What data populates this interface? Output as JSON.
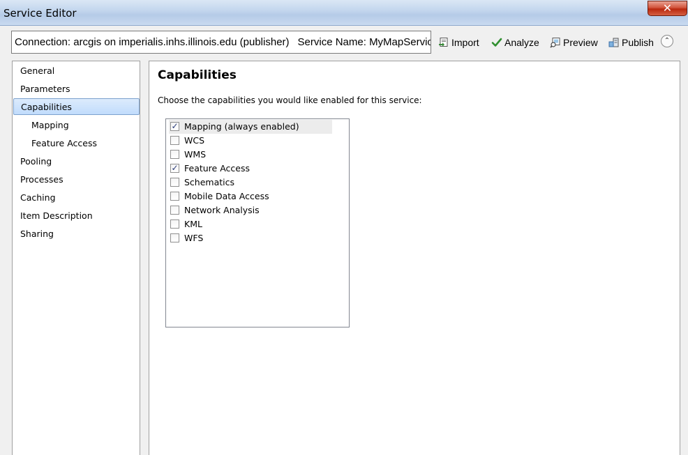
{
  "window": {
    "title": "Service Editor",
    "close_label": "✕"
  },
  "header": {
    "connection_text": "Connection: arcgis on imperialis.inhs.illinois.edu (publisher)",
    "service_text": "Service Name: MyMapService"
  },
  "toolbar": {
    "import_label": "Import",
    "analyze_label": "Analyze",
    "preview_label": "Preview",
    "publish_label": "Publish",
    "collapse_label": "⌃"
  },
  "sidebar": {
    "items": [
      {
        "label": "General"
      },
      {
        "label": "Parameters"
      },
      {
        "label": "Capabilities"
      },
      {
        "label": "Mapping"
      },
      {
        "label": "Feature Access"
      },
      {
        "label": "Pooling"
      },
      {
        "label": "Processes"
      },
      {
        "label": "Caching"
      },
      {
        "label": "Item Description"
      },
      {
        "label": "Sharing"
      }
    ],
    "selected": "Capabilities"
  },
  "main": {
    "heading": "Capabilities",
    "description": "Choose the capabilities you would like enabled for this service:",
    "capabilities": [
      {
        "label": "Mapping (always enabled)",
        "checked": true
      },
      {
        "label": "WCS",
        "checked": false
      },
      {
        "label": "WMS",
        "checked": false
      },
      {
        "label": "Feature Access",
        "checked": true
      },
      {
        "label": "Schematics",
        "checked": false
      },
      {
        "label": "Mobile Data Access",
        "checked": false
      },
      {
        "label": "Network Analysis",
        "checked": false
      },
      {
        "label": "KML",
        "checked": false
      },
      {
        "label": "WFS",
        "checked": false
      }
    ],
    "check_glyph": "✓"
  },
  "colors": {
    "analyze_check": "#2f8f2f",
    "selection": "#c1dcfc"
  }
}
